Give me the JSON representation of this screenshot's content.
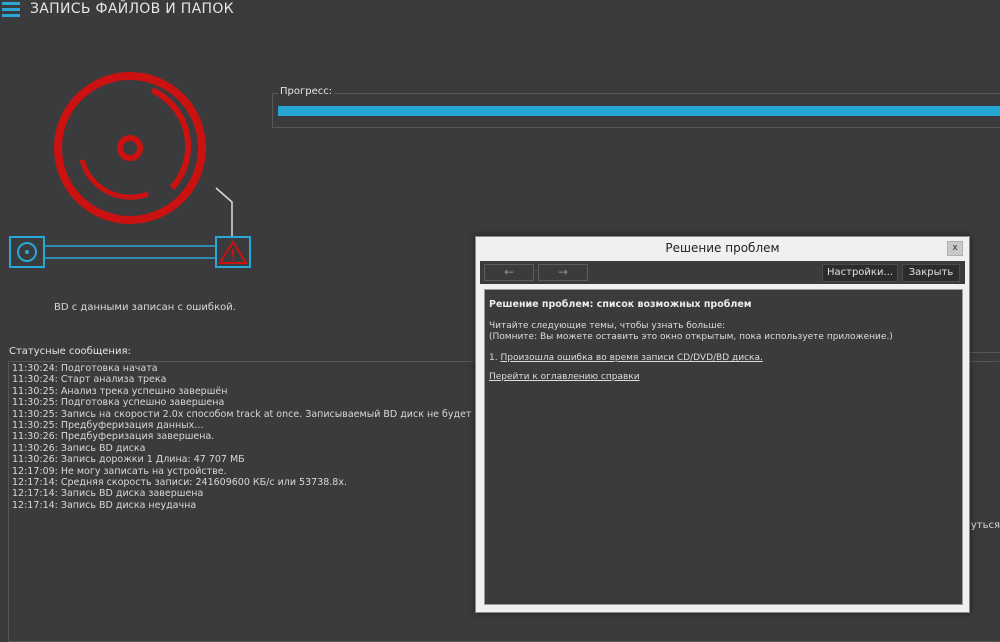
{
  "header": {
    "title": "ЗАПИСЬ ФАЙЛОВ И ПАПОК",
    "menu_icon": "hamburger-menu-icon",
    "accent": "#2aa7d6"
  },
  "progress": {
    "label": "Прогресс:",
    "value": 1.0,
    "color": "#25a6d3"
  },
  "burn_status": {
    "text": "BD с данными записан с ошибкой.",
    "error_color": "#cc1111"
  },
  "messages": {
    "label": "Статусные сообщения:",
    "items": [
      "11:30:24: Подготовка начата",
      "11:30:24: Старт анализа трека",
      "11:30:25: Анализ трека успешно завершён",
      "11:30:25: Подготовка успешно завершена",
      "11:30:25: Запись на скорости 2.0x способом track at once. Записываемый BD диск не будет финализирован.",
      "11:30:25: Предбуферизация данных...",
      "11:30:26: Предбуферизация завершена.",
      "11:30:26: Запись BD диска",
      "11:30:26: Запись дорожки 1 Длина: 47 707 МБ",
      "12:17:09: Не могу записать на устройстве.",
      "12:17:14: Средняя скорость записи: 241609600 КБ/с или 53738.8x.",
      "12:17:14: Запись BD диска завершена",
      "12:17:14: Запись BD диска неудачна"
    ],
    "right_clip": "рнуться"
  },
  "dialog": {
    "title": "Решение проблем",
    "close": "x",
    "back": "←",
    "forward": "→",
    "settings": "Настройки...",
    "close_button": "Закрыть",
    "heading": "Решение проблем: список возможных проблем",
    "intro1": "Читайте следующие темы, чтобы узнать больше:",
    "intro2": "(Помните: Вы можете оставить это окно открытым, пока используете приложение.)",
    "item_number": "1.",
    "item_link": "Произошла ошибка во время записи CD/DVD/BD диска.",
    "toc_link": "Перейти к оглавлению справки"
  }
}
